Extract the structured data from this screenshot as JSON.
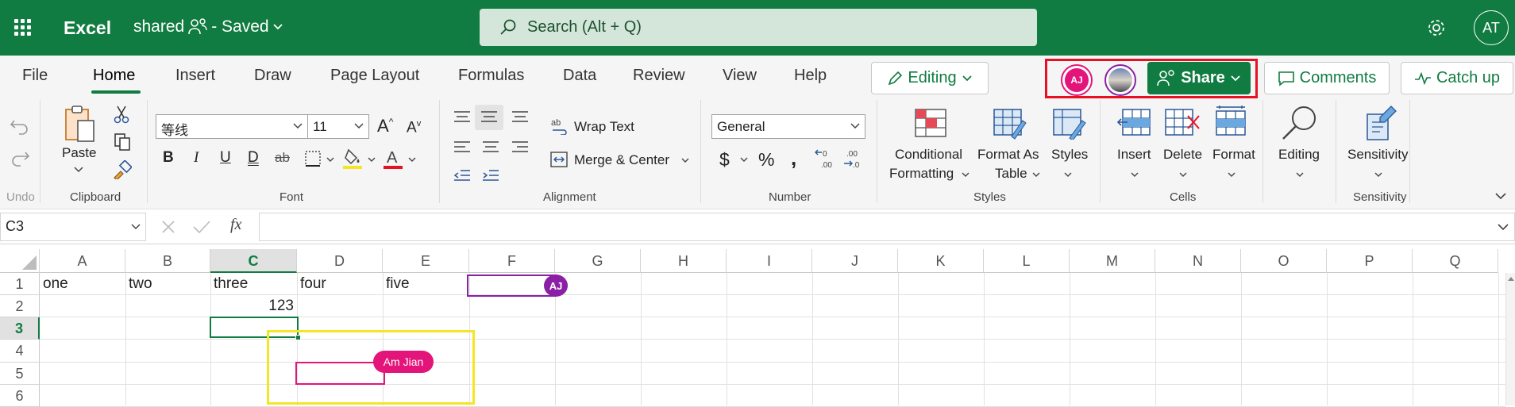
{
  "titlebar": {
    "app": "Excel",
    "doc": "shared",
    "status": "- Saved",
    "search_placeholder": "Search (Alt + Q)",
    "user_initials": "AT"
  },
  "tabs": [
    "File",
    "Home",
    "Insert",
    "Draw",
    "Page Layout",
    "Formulas",
    "Data",
    "Review",
    "View",
    "Help"
  ],
  "editing_label": "Editing",
  "collab_initials": "AJ",
  "share_label": "Share",
  "comments_label": "Comments",
  "catchup_label": "Catch up",
  "ribbon": {
    "undo_label": "Undo",
    "paste_label": "Paste",
    "clipboard_label": "Clipboard",
    "font_name": "等线",
    "font_size": "11",
    "font_label": "Font",
    "wrap_text": "Wrap Text",
    "merge_center": "Merge & Center",
    "alignment_label": "Alignment",
    "number_format": "General",
    "number_label": "Number",
    "cond_fmt_1": "Conditional",
    "cond_fmt_2": "Formatting",
    "fmt_table_1": "Format As",
    "fmt_table_2": "Table",
    "styles": "Styles",
    "styles_label": "Styles",
    "insert": "Insert",
    "delete": "Delete",
    "format": "Format",
    "cells_label": "Cells",
    "editing": "Editing",
    "sensitivity": "Sensitivity",
    "sensitivity_label": "Sensitivity"
  },
  "namebox": "C3",
  "columns": [
    "A",
    "B",
    "C",
    "D",
    "E",
    "F",
    "G",
    "H",
    "I",
    "J",
    "K",
    "L",
    "M",
    "N",
    "O",
    "P",
    "Q"
  ],
  "rows": [
    "1",
    "2",
    "3",
    "4",
    "5",
    "6"
  ],
  "cells": {
    "A1": "one",
    "B1": "two",
    "C1": "three",
    "D1": "four",
    "E1": "five",
    "C2": "123"
  },
  "presence": {
    "f1_initials": "AJ",
    "am_name": "Am Jian"
  },
  "colors": {
    "brand": "#107c41",
    "highlight_red": "#e81123",
    "highlight_yellow": "#f5e625",
    "presence_purple": "#8b1fa6",
    "presence_pink": "#e3147a"
  }
}
